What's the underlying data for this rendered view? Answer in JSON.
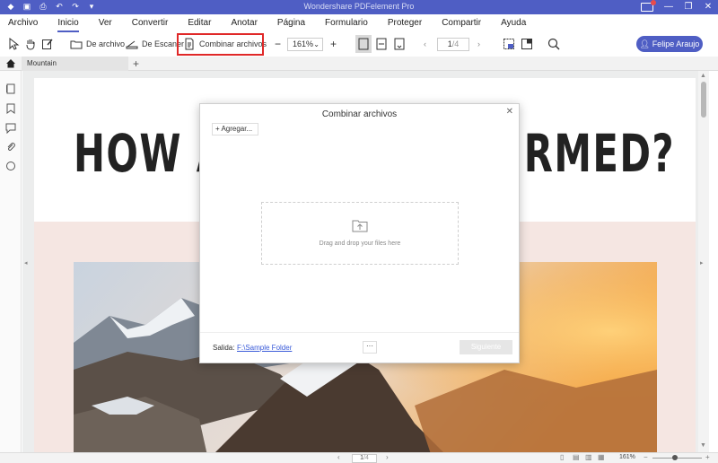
{
  "window": {
    "title": "Wondershare PDFelement Pro"
  },
  "menu": [
    "Archivo",
    "Inicio",
    "Ver",
    "Convertir",
    "Editar",
    "Anotar",
    "Página",
    "Formulario",
    "Proteger",
    "Compartir",
    "Ayuda"
  ],
  "active_menu": "Inicio",
  "toolbar": {
    "from_file": "De archivo",
    "from_scanner": "De Escaner",
    "combine": "Combinar archivos",
    "zoom": "161%",
    "page_input": "1",
    "page_total": "/4",
    "user": "Felipe Araujo"
  },
  "tabs": {
    "doc": "Mountain",
    "add": "+"
  },
  "document": {
    "headline_left": "HOW A",
    "headline_right": "RMED?"
  },
  "dialog": {
    "title": "Combinar archivos",
    "add_button": "+ Agregar...",
    "drop_text": "Drag and drop your files here",
    "output_label": "Salida:",
    "output_path": "F:\\Sample Folder",
    "browse": "···",
    "next": "Siguiente"
  },
  "status": {
    "page": "1",
    "total": "/4",
    "zoom": "161%"
  },
  "colors": {
    "accent": "#4f5ec4",
    "highlight": "#e02828",
    "link": "#3a5bd9"
  },
  "icons": [
    "select-icon",
    "hand-icon",
    "edit-icon",
    "folder-icon",
    "scanner-icon",
    "combine-icon",
    "zoom-out-icon",
    "zoom-in-icon",
    "fit-page-icon",
    "fit-width-icon",
    "single-page-icon",
    "prev-icon",
    "next-icon",
    "screenshot-icon",
    "view-mode-icon",
    "search-icon",
    "user-icon",
    "home-icon",
    "thumbnails-icon",
    "bookmark-icon",
    "comment-icon",
    "attachment-icon",
    "search-panel-icon",
    "close-icon",
    "upload-folder-icon"
  ]
}
